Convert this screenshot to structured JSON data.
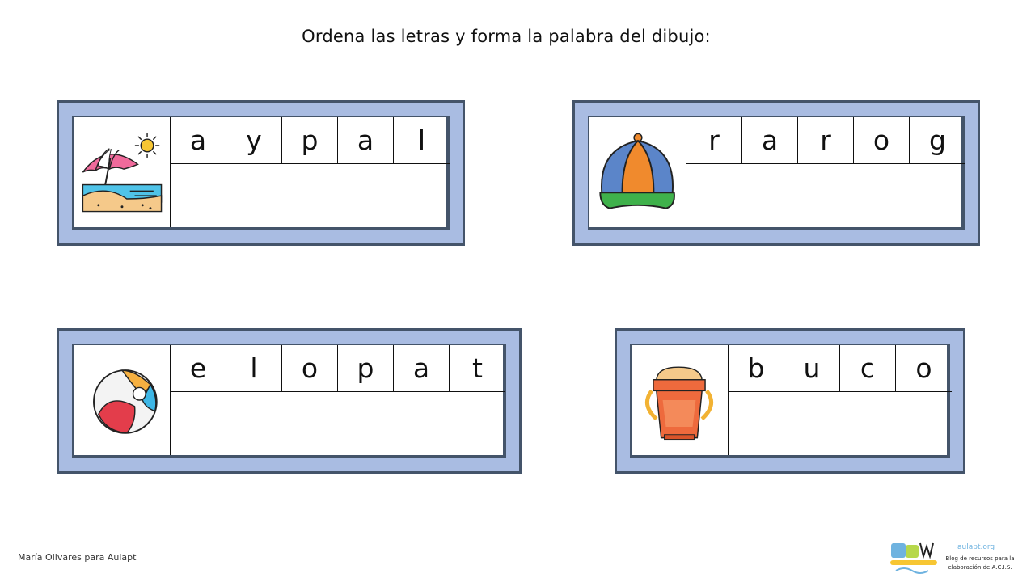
{
  "instruction": "Ordena las letras y forma la palabra del dibujo:",
  "cards": [
    {
      "image": "beach-umbrella-icon",
      "letters": [
        "a",
        "y",
        "p",
        "a",
        "l"
      ],
      "answer": ""
    },
    {
      "image": "cap-icon",
      "letters": [
        "r",
        "a",
        "r",
        "o",
        "g"
      ],
      "answer": ""
    },
    {
      "image": "beach-ball-icon",
      "letters": [
        "e",
        "l",
        "o",
        "p",
        "a",
        "t"
      ],
      "answer": ""
    },
    {
      "image": "sand-bucket-icon",
      "letters": [
        "b",
        "u",
        "c",
        "o"
      ],
      "answer": ""
    }
  ],
  "footer": {
    "credit": "María Olivares para Aulapt",
    "logo_url": "aulapt.org",
    "logo_tagline": "Blog de recursos para la elaboración de A.C.I.S."
  },
  "colors": {
    "card_bg": "#a9bce2",
    "card_border": "#44546a"
  }
}
